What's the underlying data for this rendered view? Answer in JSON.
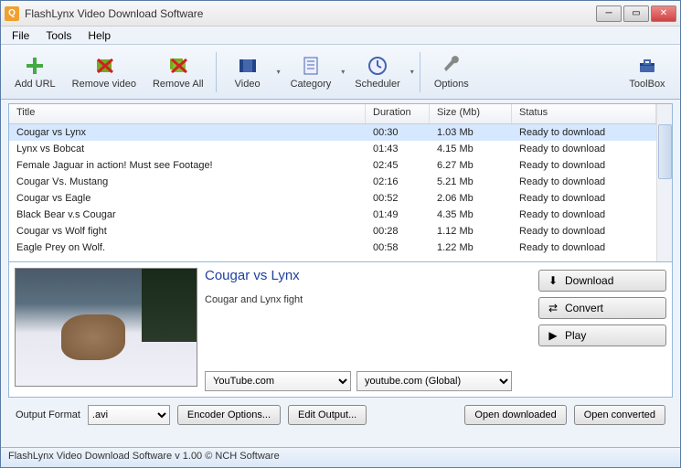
{
  "window": {
    "title": "FlashLynx Video Download Software",
    "icon_letter": "Q"
  },
  "menu": {
    "file": "File",
    "tools": "Tools",
    "help": "Help"
  },
  "toolbar": {
    "add_url": "Add URL",
    "remove_video": "Remove video",
    "remove_all": "Remove All",
    "video": "Video",
    "category": "Category",
    "scheduler": "Scheduler",
    "options": "Options",
    "toolbox": "ToolBox"
  },
  "list": {
    "headers": {
      "title": "Title",
      "duration": "Duration",
      "size": "Size (Mb)",
      "status": "Status"
    },
    "rows": [
      {
        "title": "Cougar vs Lynx",
        "duration": "00:30",
        "size": "1.03 Mb",
        "status": "Ready to download",
        "selected": true
      },
      {
        "title": "Lynx vs Bobcat",
        "duration": "01:43",
        "size": "4.15 Mb",
        "status": "Ready to download"
      },
      {
        "title": "Female Jaguar in action! Must see Footage!",
        "duration": "02:45",
        "size": "6.27 Mb",
        "status": "Ready to download"
      },
      {
        "title": "Cougar Vs. Mustang",
        "duration": "02:16",
        "size": "5.21 Mb",
        "status": "Ready to download"
      },
      {
        "title": "Cougar vs Eagle",
        "duration": "00:52",
        "size": "2.06 Mb",
        "status": "Ready to download"
      },
      {
        "title": "Black Bear v.s Cougar",
        "duration": "01:49",
        "size": "4.35 Mb",
        "status": "Ready to download"
      },
      {
        "title": "Cougar vs Wolf fight",
        "duration": "00:28",
        "size": "1.12 Mb",
        "status": "Ready to download"
      },
      {
        "title": "Eagle Prey on Wolf.",
        "duration": "00:58",
        "size": "1.22 Mb",
        "status": "Ready to download"
      }
    ]
  },
  "preview": {
    "title": "Cougar vs Lynx",
    "description": "Cougar and Lynx fight",
    "source_select": "YouTube.com",
    "region_select": "youtube.com (Global)"
  },
  "actions": {
    "download": "Download",
    "convert": "Convert",
    "play": "Play"
  },
  "bottom": {
    "output_format_label": "Output Format",
    "format_value": ".avi",
    "encoder_options": "Encoder Options...",
    "edit_output": "Edit Output...",
    "open_downloaded": "Open downloaded",
    "open_converted": "Open converted"
  },
  "status": "FlashLynx Video Download Software v 1.00 © NCH Software"
}
